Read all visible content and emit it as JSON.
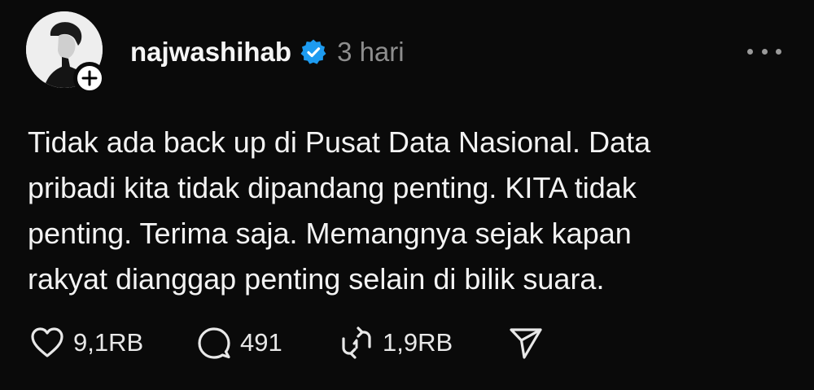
{
  "post": {
    "username": "najwashihab",
    "time": "3 hari",
    "lines": [
      "Tidak ada back up di Pusat Data Nasional. Data",
      "pribadi kita tidak dipandang penting. KITA tidak",
      "penting. Terima saja. Memangnya sejak kapan",
      "rakyat dianggap penting selain di bilik suara."
    ]
  },
  "actions": {
    "likes": "9,1RB",
    "replies": "491",
    "reposts": "1,9RB"
  },
  "icons": {
    "avatar": "profile-photo",
    "follow": "plus-icon",
    "verified": "verified-badge-icon",
    "more": "more-dots-icon",
    "like": "heart-icon",
    "reply": "comment-bubble-icon",
    "repost": "repost-icon",
    "share": "send-icon"
  },
  "colors": {
    "background": "#0a0a0a",
    "verified": "#1d9bf0",
    "muted": "#8e8e8e"
  }
}
